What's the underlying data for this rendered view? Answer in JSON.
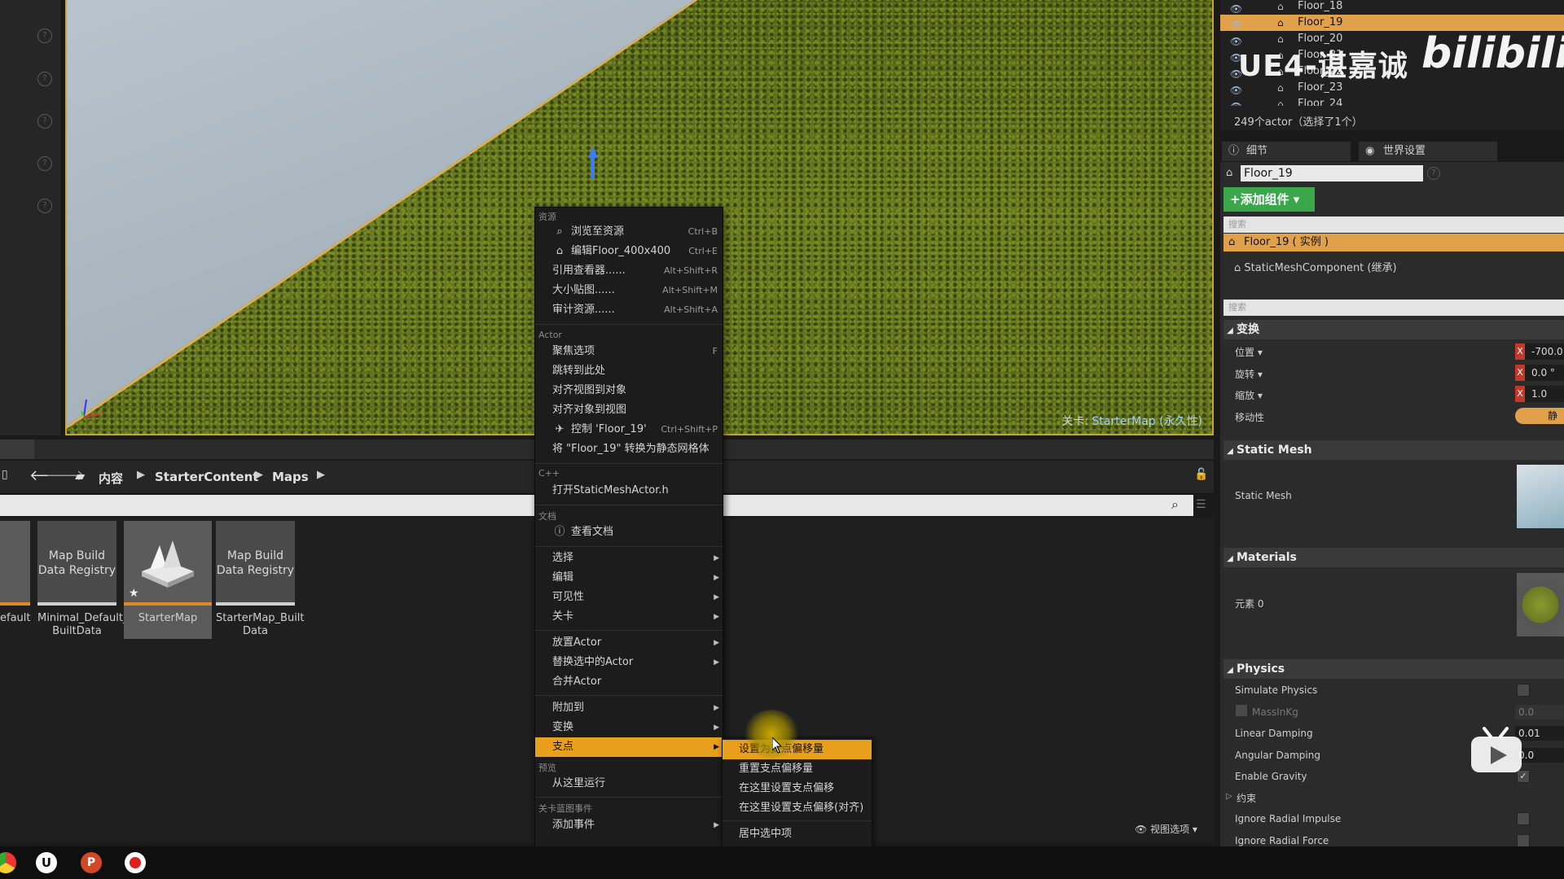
{
  "viewport": {
    "level_label": "关卡:",
    "level_name": "StarterMap (永久性)"
  },
  "content_browser": {
    "breadcrumb": [
      "内容",
      "StarterContent",
      "Maps"
    ],
    "assets": [
      {
        "thumb": "",
        "name": "efault"
      },
      {
        "thumb": "Map Build Data Registry",
        "name": "Minimal_Default_ BuiltData"
      },
      {
        "thumb": "",
        "name": "StarterMap"
      },
      {
        "thumb": "Map Build Data Registry",
        "name": "StarterMap_Built Data"
      }
    ],
    "view_options": "视图选项"
  },
  "context_menu": {
    "sections": {
      "assets": "资源",
      "actor": "Actor",
      "cpp": "C++",
      "docs": "文档",
      "preview": "预览",
      "level_bp": "关卡蓝图事件"
    },
    "items": [
      {
        "label": "浏览至资源",
        "shortcut": "Ctrl+B"
      },
      {
        "label": "编辑Floor_400x400",
        "shortcut": "Ctrl+E"
      },
      {
        "label": "引用查看器......",
        "shortcut": "Alt+Shift+R"
      },
      {
        "label": "大小贴图......",
        "shortcut": "Alt+Shift+M"
      },
      {
        "label": "审计资源......",
        "shortcut": "Alt+Shift+A"
      },
      {
        "label": "聚焦选项",
        "shortcut": "F"
      },
      {
        "label": "跳转到此处",
        "shortcut": ""
      },
      {
        "label": "对齐视图到对象",
        "shortcut": ""
      },
      {
        "label": "对齐对象到视图",
        "shortcut": ""
      },
      {
        "label": "控制 'Floor_19'",
        "shortcut": "Ctrl+Shift+P"
      },
      {
        "label": "将 \"Floor_19\" 转换为静态网格体",
        "shortcut": ""
      },
      {
        "label": "打开StaticMeshActor.h",
        "shortcut": ""
      },
      {
        "label": "查看文档",
        "shortcut": ""
      },
      {
        "label": "选择",
        "shortcut": ""
      },
      {
        "label": "编辑",
        "shortcut": ""
      },
      {
        "label": "可见性",
        "shortcut": ""
      },
      {
        "label": "关卡",
        "shortcut": ""
      },
      {
        "label": "放置Actor",
        "shortcut": ""
      },
      {
        "label": "替换选中的Actor",
        "shortcut": ""
      },
      {
        "label": "合并Actor",
        "shortcut": ""
      },
      {
        "label": "附加到",
        "shortcut": ""
      },
      {
        "label": "变换",
        "shortcut": ""
      },
      {
        "label": "支点",
        "shortcut": ""
      },
      {
        "label": "从这里运行",
        "shortcut": ""
      },
      {
        "label": "添加事件",
        "shortcut": ""
      }
    ],
    "submenu": [
      "设置为支点偏移量",
      "重置支点偏移量",
      "在这里设置支点偏移",
      "在这里设置支点偏移(对齐)",
      "居中选中项"
    ]
  },
  "outliner": {
    "rows": [
      "Floor_18",
      "Floor_19",
      "Floor_20",
      "Floor_21",
      "Floor_22",
      "Floor_23",
      "Floor_24"
    ],
    "count": "249个actor（选择了1个）"
  },
  "watermark": {
    "text": "UE4-谌嘉诚",
    "logo": "bilibili"
  },
  "details": {
    "tab_details": "细节",
    "tab_world": "世界设置",
    "name": "Floor_19",
    "add_component": "+添加组件 ▾",
    "search": "搜索",
    "root_component": "Floor_19 ( 实例 )",
    "child_component": "StaticMeshComponent (继承)",
    "transform": {
      "title": "变换",
      "location": "位置 ▾",
      "rotation": "旋转 ▾",
      "scale": "缩放 ▾",
      "mobility": "移动性",
      "location_x": "-700.0",
      "rotation_x": "0.0 °",
      "scale_x": "1.0",
      "mobility_value": "静",
      "x": "X"
    },
    "static_mesh": {
      "title": "Static Mesh",
      "label": "Static Mesh"
    },
    "materials": {
      "title": "Materials",
      "element": "元素 0"
    },
    "physics": {
      "title": "Physics",
      "simulate": "Simulate Physics",
      "mass": "MassInKg",
      "mass_value": "0.0",
      "linear": "Linear Damping",
      "linear_value": "0.01",
      "angular": "Angular Damping",
      "angular_value": "0.0",
      "gravity": "Enable Gravity",
      "constraints": "约束",
      "radial_impulse": "Ignore Radial Impulse",
      "radial_force": "Ignore Radial Force"
    }
  },
  "colors": {
    "accent": "#e8a01c",
    "selection": "#e0a14a",
    "add_button": "#3aa84a",
    "viewport_border": "#c9a042"
  }
}
